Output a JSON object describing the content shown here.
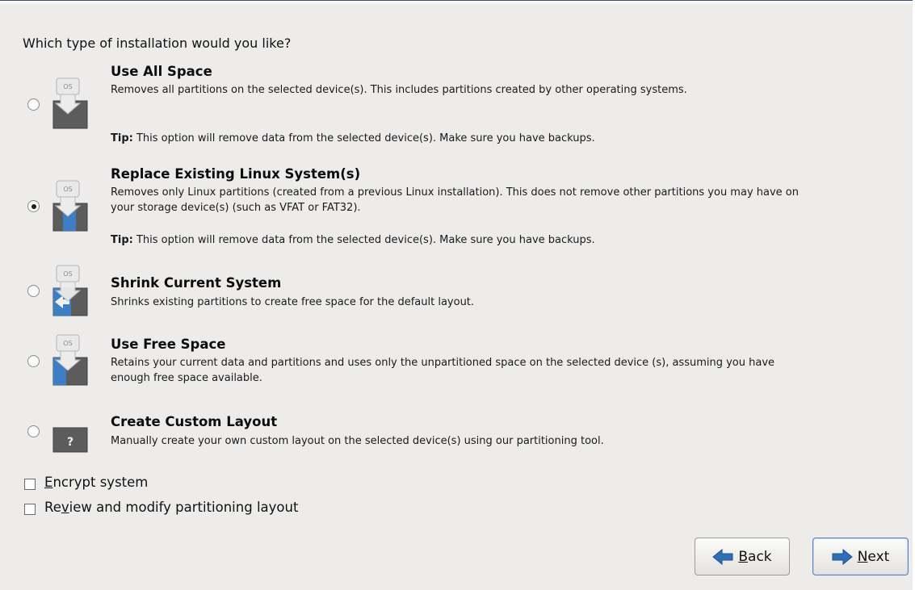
{
  "question": "Which type of installation would you like?",
  "options": [
    {
      "title": "Use All Space",
      "desc": "Removes all partitions on the selected device(s).  This includes partitions created by other operating systems.",
      "tip_label": "Tip:",
      "tip": " This option will remove data from the selected device(s).  Make sure you have backups.",
      "selected": false,
      "icon": "disk-all-space-icon"
    },
    {
      "title": "Replace Existing Linux System(s)",
      "desc": "Removes only Linux partitions (created from a previous Linux installation).  This does not remove other partitions you may have on your storage device(s) (such as VFAT or FAT32).",
      "tip_label": "Tip:",
      "tip": " This option will remove data from the selected device(s).  Make sure you have backups.",
      "selected": true,
      "icon": "disk-replace-linux-icon"
    },
    {
      "title": "Shrink Current System",
      "desc": "Shrinks existing partitions to create free space for the default layout.",
      "selected": false,
      "icon": "disk-shrink-icon"
    },
    {
      "title": "Use Free Space",
      "desc": "Retains your current data and partitions and uses only the unpartitioned space on the selected device (s), assuming you have enough free space available.",
      "selected": false,
      "icon": "disk-free-space-icon"
    },
    {
      "title": "Create Custom Layout",
      "desc": "Manually create your own custom layout on the selected device(s) using our partitioning tool.",
      "selected": false,
      "icon": "disk-custom-icon"
    }
  ],
  "icon_os_label": "OS",
  "icon_custom_label": "?",
  "checkboxes": {
    "encrypt": {
      "pre": "",
      "mnemonic": "E",
      "post": "ncrypt system",
      "checked": false
    },
    "review": {
      "pre": "Re",
      "mnemonic": "v",
      "post": "iew and modify partitioning layout",
      "checked": false
    }
  },
  "buttons": {
    "back": {
      "mnemonic": "B",
      "rest": "ack"
    },
    "next": {
      "mnemonic": "N",
      "rest": "ext"
    }
  },
  "colors": {
    "background": "#edeceb",
    "disk_dark": "#5c5c5c",
    "linux_blue": "#3d7ec4",
    "arrow_blue": "#2f6fb8"
  }
}
